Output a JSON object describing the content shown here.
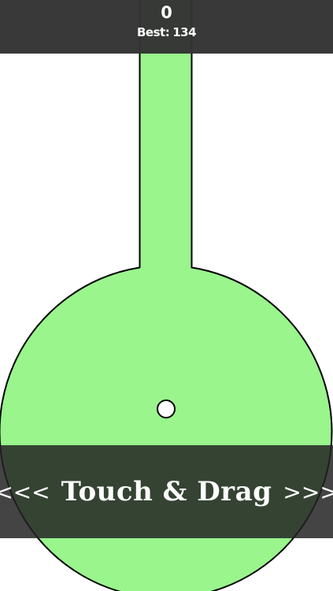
{
  "hud": {
    "score": "0",
    "best_label": "Best:",
    "best_value": "134"
  },
  "banner": {
    "left_arrows": "<<<",
    "title": "Touch & Drag",
    "right_arrows": ">>>"
  },
  "colors": {
    "shape_fill": "#99f58c",
    "outline": "#000000",
    "hud_bg": "#333333",
    "ball": "#ffffff"
  }
}
